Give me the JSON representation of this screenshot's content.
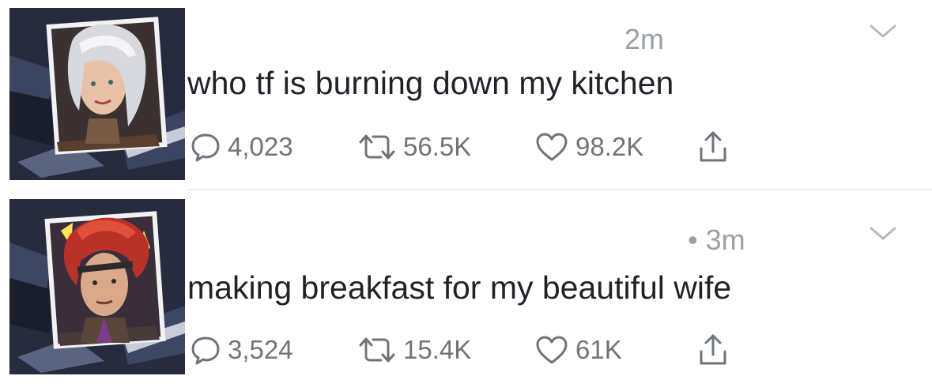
{
  "tweets": [
    {
      "time": "2m",
      "text": "who tf is burning down my kitchen",
      "replies": "4,023",
      "retweets": "56.5K",
      "likes": "98.2K"
    },
    {
      "time": "• 3m",
      "text": "making breakfast for my beautiful wife",
      "replies": "3,524",
      "retweets": "15.4K",
      "likes": "61K"
    }
  ],
  "icons": {
    "menu": "chevron-down-icon",
    "reply": "reply-icon",
    "retweet": "retweet-icon",
    "like": "heart-icon",
    "share": "share-icon"
  },
  "colors": {
    "text": "#1f2328",
    "muted": "#6e7479",
    "timestamp": "#9aa0a6",
    "divider": "#eceef0",
    "avatar_bg": "#262b3d"
  }
}
